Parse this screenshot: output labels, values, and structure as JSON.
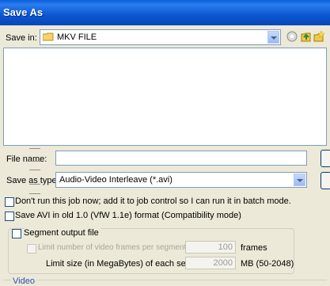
{
  "window": {
    "title": "Save As"
  },
  "save_in": {
    "label": "Save in:",
    "value": "MKV FILE",
    "folder_icon": "folder-icon"
  },
  "toolbar": {
    "icons": [
      "back-icon",
      "up-folder-icon",
      "new-folder-icon",
      "view-menu-icon"
    ]
  },
  "file_name": {
    "label": "File name:",
    "value": ""
  },
  "save_as_type": {
    "label": "Save as type:",
    "value": "Audio-Video Interleave (*.avi)"
  },
  "options": {
    "dont_run": "Don't run this job now; add it to job control so I can run it in batch mode.",
    "old_avi": "Save AVI in old 1.0 (VfW 1.1e) format (Compatibility mode)",
    "segment_output": "Segment output file",
    "limit_frames_label": "Limit number of video frames per segment to :",
    "limit_frames_value": "100",
    "limit_frames_unit": "frames",
    "limit_size_label": "Limit size (in MegaBytes) of each segment to :",
    "limit_size_value": "2000",
    "limit_size_unit": "MB (50-2048)",
    "video_section": "Video"
  },
  "colors": {
    "titlebar": "#0b57d0",
    "dialog_bg": "#ece9d8"
  }
}
